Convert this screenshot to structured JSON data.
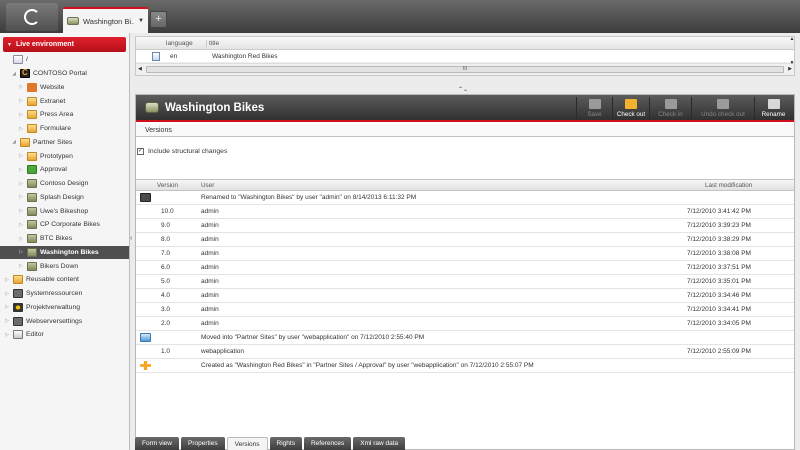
{
  "tab": {
    "label": "Washington Bi..."
  },
  "live_environment": "Live environment",
  "tree": [
    {
      "label": "/",
      "icon": "page-icon",
      "indent": 0
    },
    {
      "label": "CONTOSO Portal",
      "icon": "contoso-logo-icon",
      "indent": 1
    },
    {
      "label": "Website",
      "icon": "home-icon",
      "indent": 2
    },
    {
      "label": "Extranet",
      "icon": "folder-icon",
      "indent": 2
    },
    {
      "label": "Press Area",
      "icon": "folder-icon",
      "indent": 2
    },
    {
      "label": "Formulare",
      "icon": "folder-icon",
      "indent": 2
    },
    {
      "label": "Partner Sites",
      "icon": "folder-icon",
      "indent": 1
    },
    {
      "label": "Prototypen",
      "icon": "folder-icon",
      "indent": 2
    },
    {
      "label": "Approval",
      "icon": "approval-icon",
      "indent": 2
    },
    {
      "label": "Contoso Design",
      "icon": "bike-icon",
      "indent": 2
    },
    {
      "label": "Splash Design",
      "icon": "bike-icon",
      "indent": 2
    },
    {
      "label": "Uwe's Bikeshop",
      "icon": "bike-icon",
      "indent": 2
    },
    {
      "label": "CP Corporate Bikes",
      "icon": "bike-icon",
      "indent": 2
    },
    {
      "label": "BTC Bikes",
      "icon": "bike-icon",
      "indent": 2
    },
    {
      "label": "Washington Bikes",
      "icon": "bike-icon",
      "indent": 2,
      "selected": true
    },
    {
      "label": "Bikers Down",
      "icon": "bike-icon",
      "indent": 2
    },
    {
      "label": "Reusable content",
      "icon": "folder-icon",
      "indent": 0
    },
    {
      "label": "Systemressourcen",
      "icon": "system-icon",
      "indent": 0
    },
    {
      "label": "Projektverwaltung",
      "icon": "project-icon",
      "indent": 0
    },
    {
      "label": "Webserversettings",
      "icon": "system-icon",
      "indent": 0
    },
    {
      "label": "Editor",
      "icon": "editor-icon",
      "indent": 0
    }
  ],
  "lang_panel": {
    "headers": [
      "language",
      "title"
    ],
    "rows": [
      {
        "language": "en",
        "title": "Washington Red Bikes"
      }
    ],
    "scroll_thumb": "III"
  },
  "main": {
    "title": "Washington Bikes",
    "toolbar": [
      {
        "label": "Save",
        "enabled": false
      },
      {
        "label": "Check out",
        "enabled": true
      },
      {
        "label": "Check in",
        "enabled": false
      },
      {
        "label": "Undo check out",
        "enabled": false
      },
      {
        "label": "Rename",
        "enabled": true
      }
    ],
    "section": "Versions",
    "checkbox_label": "Include structural changes",
    "columns": {
      "version": "Version",
      "user": "User",
      "last": "Last modification"
    },
    "rows": [
      {
        "kind": "event",
        "icon": "rename-icon",
        "text": "Renamed to \"Washington Bikes\" by user \"admin\" on 8/14/2013 6:11:32 PM"
      },
      {
        "kind": "version",
        "version": "10.0",
        "user": "admin",
        "date": "7/12/2010 3:41:42 PM"
      },
      {
        "kind": "version",
        "version": "9.0",
        "user": "admin",
        "date": "7/12/2010 3:39:23 PM"
      },
      {
        "kind": "version",
        "version": "8.0",
        "user": "admin",
        "date": "7/12/2010 3:38:29 PM"
      },
      {
        "kind": "version",
        "version": "7.0",
        "user": "admin",
        "date": "7/12/2010 3:38:08 PM"
      },
      {
        "kind": "version",
        "version": "6.0",
        "user": "admin",
        "date": "7/12/2010 3:37:51 PM"
      },
      {
        "kind": "version",
        "version": "5.0",
        "user": "admin",
        "date": "7/12/2010 3:35:01 PM"
      },
      {
        "kind": "version",
        "version": "4.0",
        "user": "admin",
        "date": "7/12/2010 3:34:46 PM"
      },
      {
        "kind": "version",
        "version": "3.0",
        "user": "admin",
        "date": "7/12/2010 3:34:41 PM"
      },
      {
        "kind": "version",
        "version": "2.0",
        "user": "admin",
        "date": "7/12/2010 3:34:05 PM"
      },
      {
        "kind": "event",
        "icon": "move-icon",
        "text": "Moved into \"Partner Sites\" by user \"webapplication\" on 7/12/2010 2:55:40 PM"
      },
      {
        "kind": "version",
        "version": "1.0",
        "user": "webapplication",
        "date": "7/12/2010 2:55:09 PM"
      },
      {
        "kind": "event",
        "icon": "create-icon",
        "text": "Created as \"Washington Red Bikes\" in \"Partner Sites / Approval\" by user \"webapplication\" on 7/12/2010 2:55:07 PM"
      }
    ]
  },
  "bottom_tabs": [
    {
      "label": "Form view",
      "active": false
    },
    {
      "label": "Properties",
      "active": false
    },
    {
      "label": "Versions",
      "active": true
    },
    {
      "label": "Rights",
      "active": false
    },
    {
      "label": "References",
      "active": false
    },
    {
      "label": "Xml raw data",
      "active": false
    }
  ],
  "colors": {
    "accent": "#d0101c",
    "header_dark": "#3c3c3c"
  }
}
